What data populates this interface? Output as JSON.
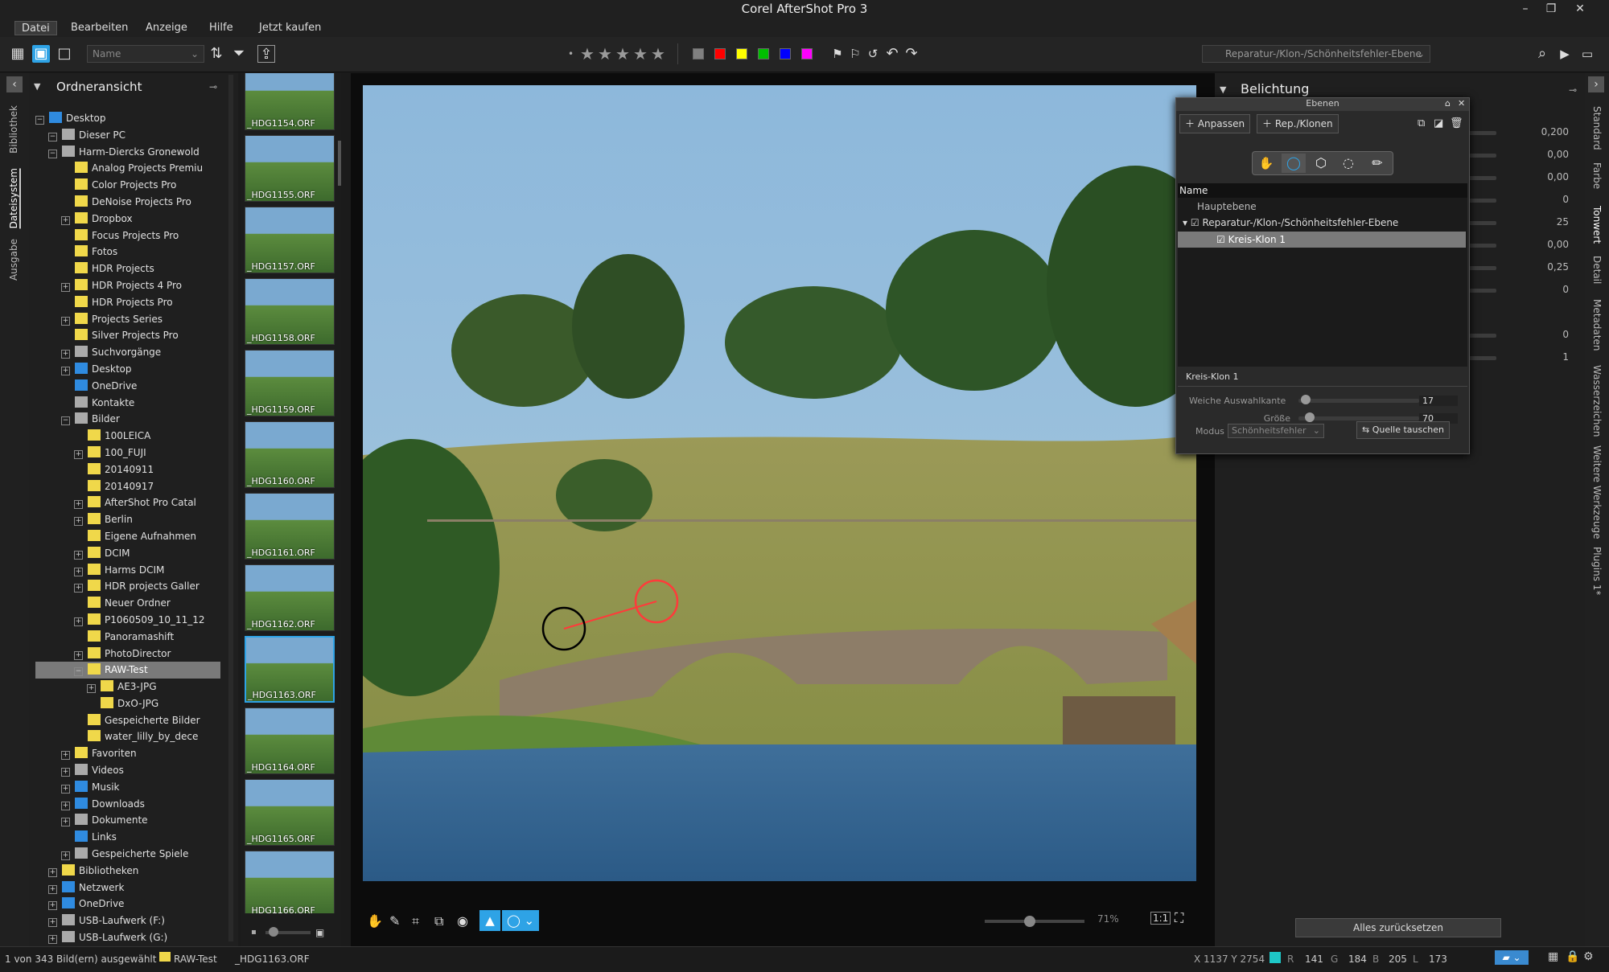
{
  "app": {
    "title": "Corel AfterShot Pro 3"
  },
  "window": {
    "minimize": "–",
    "maximize": "❐",
    "close": "✕"
  },
  "menu": [
    "Datei",
    "Bearbeiten",
    "Anzeige",
    "Hilfe",
    "Jetzt kaufen"
  ],
  "toolbar": {
    "sort_value": "Name",
    "layer_select": "Reparatur-/Klon-/Schönheitsfehler-Ebene",
    "stars": [
      "★",
      "★",
      "★",
      "★",
      "★"
    ],
    "color_labels": [
      "#808080",
      "#ff0000",
      "#ffff00",
      "#00c000",
      "#0000ff",
      "#ff00ff"
    ]
  },
  "left_rail": [
    "Bibliothek",
    "Dateisystem",
    "Ausgabe"
  ],
  "tree": {
    "title": "Ordneransicht",
    "items": [
      {
        "label": "Desktop",
        "indent": 0,
        "icon": "blue",
        "exp": "−"
      },
      {
        "label": "Dieser PC",
        "indent": 1,
        "icon": "gray",
        "exp": "−"
      },
      {
        "label": "Harm-Diercks Gronewold",
        "indent": 1,
        "icon": "gray",
        "exp": "−"
      },
      {
        "label": "Analog Projects Premiu",
        "indent": 2,
        "icon": "yellow",
        "exp": ""
      },
      {
        "label": "Color Projects Pro",
        "indent": 2,
        "icon": "yellow",
        "exp": ""
      },
      {
        "label": "DeNoise Projects Pro",
        "indent": 2,
        "icon": "yellow",
        "exp": ""
      },
      {
        "label": "Dropbox",
        "indent": 2,
        "icon": "yellow",
        "exp": "+"
      },
      {
        "label": "Focus Projects Pro",
        "indent": 2,
        "icon": "yellow",
        "exp": ""
      },
      {
        "label": "Fotos",
        "indent": 2,
        "icon": "yellow",
        "exp": ""
      },
      {
        "label": "HDR Projects",
        "indent": 2,
        "icon": "yellow",
        "exp": ""
      },
      {
        "label": "HDR Projects 4 Pro",
        "indent": 2,
        "icon": "yellow",
        "exp": "+"
      },
      {
        "label": "HDR Projects Pro",
        "indent": 2,
        "icon": "yellow",
        "exp": ""
      },
      {
        "label": "Projects Series",
        "indent": 2,
        "icon": "yellow",
        "exp": "+"
      },
      {
        "label": "Silver Projects Pro",
        "indent": 2,
        "icon": "yellow",
        "exp": ""
      },
      {
        "label": "Suchvorgänge",
        "indent": 2,
        "icon": "gray",
        "exp": "+"
      },
      {
        "label": "Desktop",
        "indent": 2,
        "icon": "blue",
        "exp": "+"
      },
      {
        "label": "OneDrive",
        "indent": 2,
        "icon": "blue",
        "exp": ""
      },
      {
        "label": "Kontakte",
        "indent": 2,
        "icon": "gray",
        "exp": ""
      },
      {
        "label": "Bilder",
        "indent": 2,
        "icon": "gray",
        "exp": "−"
      },
      {
        "label": "100LEICA",
        "indent": 3,
        "icon": "yellow",
        "exp": ""
      },
      {
        "label": "100_FUJI",
        "indent": 3,
        "icon": "yellow",
        "exp": "+"
      },
      {
        "label": "20140911",
        "indent": 3,
        "icon": "yellow",
        "exp": ""
      },
      {
        "label": "20140917",
        "indent": 3,
        "icon": "yellow",
        "exp": ""
      },
      {
        "label": "AfterShot Pro Catal",
        "indent": 3,
        "icon": "yellow",
        "exp": "+"
      },
      {
        "label": "Berlin",
        "indent": 3,
        "icon": "yellow",
        "exp": "+"
      },
      {
        "label": "Eigene Aufnahmen",
        "indent": 3,
        "icon": "yellow",
        "exp": ""
      },
      {
        "label": "DCIM",
        "indent": 3,
        "icon": "yellow",
        "exp": "+"
      },
      {
        "label": "Harms DCIM",
        "indent": 3,
        "icon": "yellow",
        "exp": "+"
      },
      {
        "label": "HDR projects Galler",
        "indent": 3,
        "icon": "yellow",
        "exp": "+"
      },
      {
        "label": "Neuer Ordner",
        "indent": 3,
        "icon": "yellow",
        "exp": ""
      },
      {
        "label": "P1060509_10_11_12",
        "indent": 3,
        "icon": "yellow",
        "exp": "+"
      },
      {
        "label": "Panoramashift",
        "indent": 3,
        "icon": "yellow",
        "exp": ""
      },
      {
        "label": "PhotoDirector",
        "indent": 3,
        "icon": "yellow",
        "exp": "+"
      },
      {
        "label": "RAW-Test",
        "indent": 3,
        "icon": "yellow",
        "exp": "−",
        "selected": true
      },
      {
        "label": "AE3-JPG",
        "indent": 4,
        "icon": "yellow",
        "exp": "+"
      },
      {
        "label": "DxO-JPG",
        "indent": 4,
        "icon": "yellow",
        "exp": ""
      },
      {
        "label": "Gespeicherte Bilder",
        "indent": 3,
        "icon": "yellow",
        "exp": ""
      },
      {
        "label": "water_lilly_by_dece",
        "indent": 3,
        "icon": "yellow",
        "exp": ""
      },
      {
        "label": "Favoriten",
        "indent": 2,
        "icon": "yellow",
        "exp": "+"
      },
      {
        "label": "Videos",
        "indent": 2,
        "icon": "gray",
        "exp": "+"
      },
      {
        "label": "Musik",
        "indent": 2,
        "icon": "blue",
        "exp": "+"
      },
      {
        "label": "Downloads",
        "indent": 2,
        "icon": "blue",
        "exp": "+"
      },
      {
        "label": "Dokumente",
        "indent": 2,
        "icon": "gray",
        "exp": "+"
      },
      {
        "label": "Links",
        "indent": 2,
        "icon": "blue",
        "exp": ""
      },
      {
        "label": "Gespeicherte Spiele",
        "indent": 2,
        "icon": "gray",
        "exp": "+"
      },
      {
        "label": "Bibliotheken",
        "indent": 1,
        "icon": "yellow",
        "exp": "+"
      },
      {
        "label": "Netzwerk",
        "indent": 1,
        "icon": "blue",
        "exp": "+"
      },
      {
        "label": "OneDrive",
        "indent": 1,
        "icon": "blue",
        "exp": "+"
      },
      {
        "label": "USB-Laufwerk (F:)",
        "indent": 1,
        "icon": "gray",
        "exp": "+"
      },
      {
        "label": "USB-Laufwerk (G:)",
        "indent": 1,
        "icon": "gray",
        "exp": "+"
      }
    ]
  },
  "thumbs": [
    "_HDG1154.ORF",
    "_HDG1155.ORF",
    "_HDG1157.ORF",
    "_HDG1158.ORF",
    "_HDG1159.ORF",
    "_HDG1160.ORF",
    "_HDG1161.ORF",
    "_HDG1162.ORF",
    "_HDG1163.ORF",
    "_HDG1164.ORF",
    "_HDG1165.ORF",
    "_HDG1166.ORF",
    ""
  ],
  "viewer": {
    "zoom": "71%",
    "zoom_level": 0.45
  },
  "right": {
    "section": "Belichtung",
    "values": [
      "0,200",
      "0,00",
      "0,00",
      "0",
      "25",
      "0,00",
      "0,25",
      "0",
      "0",
      "1"
    ],
    "reset": "Alles zurücksetzen"
  },
  "right_rail": [
    "Standard",
    "Farbe",
    "Tonwert",
    "Detail",
    "Metadaten",
    "Wasserzeichen",
    "Weitere Werkzeuge",
    "Plugins 1*"
  ],
  "layers": {
    "title": "Ebenen",
    "add_adjust": "Anpassen",
    "add_clone": "Rep./Klonen",
    "col_name": "Name",
    "items": [
      "Hauptebene",
      "Reparatur-/Klon-/Schönheitsfehler-Ebene",
      "Kreis-Klon 1"
    ],
    "props": {
      "title": "Kreis-Klon 1",
      "feather_label": "Weiche Auswahlkante",
      "feather_value": "17",
      "feather_level": 0.02,
      "size_label": "Größe",
      "size_value": "70",
      "size_level": 0.05,
      "mode_label": "Modus",
      "mode_value": "Schönheitsfehler",
      "swap": "Quelle tauschen"
    }
  },
  "status": {
    "count": "1 von 343 Bild(ern) ausgewählt",
    "folder": "RAW-Test",
    "file": "_HDG1163.ORF",
    "coords": "X 1137  Y 2754",
    "r_label": "R",
    "r": "141",
    "g_label": "G",
    "g": "184",
    "b_label": "B",
    "b": "205",
    "l_label": "L",
    "l": "173"
  }
}
